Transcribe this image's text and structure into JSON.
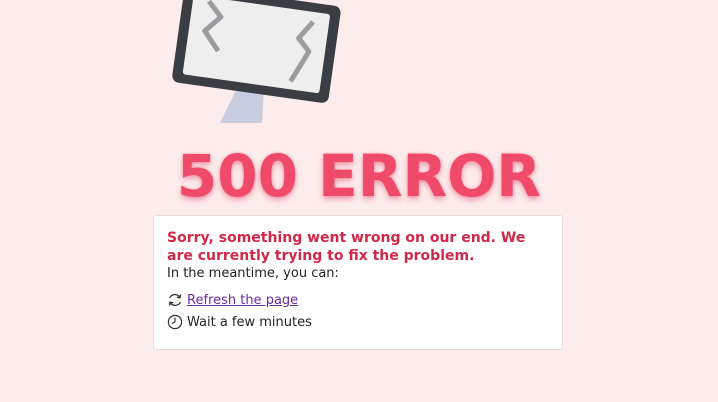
{
  "error": {
    "heading": "500 ERROR",
    "apology": "Sorry, something went wrong on our end. We are currently trying to fix the problem.",
    "intro": "In the meantime, you can:",
    "options": [
      {
        "icon": "refresh-icon",
        "label": "Refresh the page",
        "link": true
      },
      {
        "icon": "clock-icon",
        "label": "Wait a few minutes",
        "link": false
      }
    ]
  },
  "colors": {
    "background": "#fdecec",
    "heading": "#f04a6a",
    "apology": "#d1284a",
    "link": "#6a2c9e",
    "monitor_frame": "#3a3d42",
    "monitor_screen": "#eeeeee",
    "monitor_stand": "#c9cde0"
  },
  "illustration": {
    "icon": "broken-monitor-icon"
  }
}
